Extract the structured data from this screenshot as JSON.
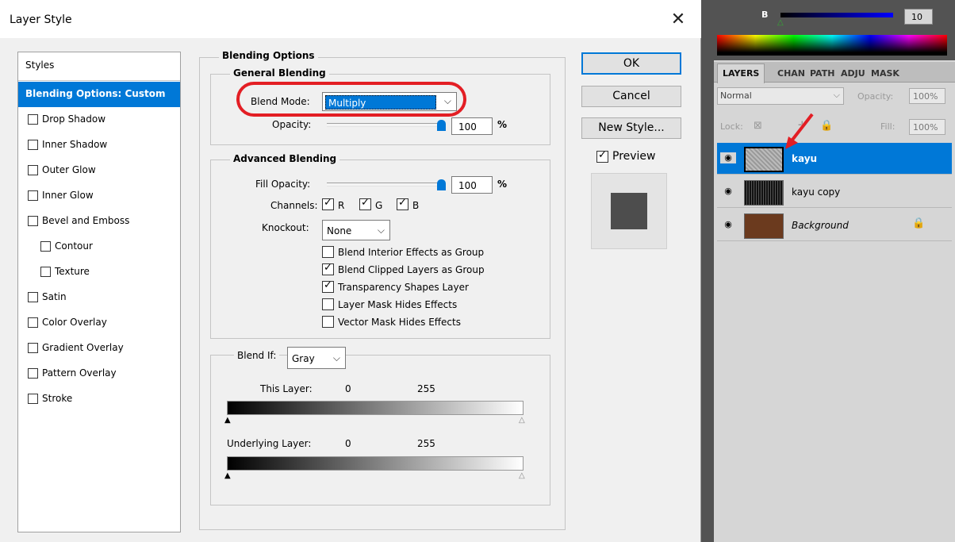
{
  "dialog": {
    "title": "Layer Style",
    "close_glyph": "✕",
    "styles": {
      "header": "Styles",
      "items": [
        {
          "label": "Blending Options: Custom",
          "selected": true,
          "checkbox": false
        },
        {
          "label": "Drop Shadow",
          "checkbox": true
        },
        {
          "label": "Inner Shadow",
          "checkbox": true
        },
        {
          "label": "Outer Glow",
          "checkbox": true
        },
        {
          "label": "Inner Glow",
          "checkbox": true
        },
        {
          "label": "Bevel and Emboss",
          "checkbox": true
        },
        {
          "label": "Contour",
          "checkbox": true
        },
        {
          "label": "Texture",
          "checkbox": true
        },
        {
          "label": "Satin",
          "checkbox": true
        },
        {
          "label": "Color Overlay",
          "checkbox": true
        },
        {
          "label": "Gradient Overlay",
          "checkbox": true
        },
        {
          "label": "Pattern Overlay",
          "checkbox": true
        },
        {
          "label": "Stroke",
          "checkbox": true
        }
      ]
    },
    "blending_options": {
      "title": "Blending Options",
      "general": {
        "title": "General Blending",
        "blend_mode_label": "Blend Mode:",
        "blend_mode_value": "Multiply",
        "opacity_label": "Opacity:",
        "opacity_value": "100",
        "unit": "%"
      },
      "advanced": {
        "title": "Advanced Blending",
        "fill_opacity_label": "Fill Opacity:",
        "fill_opacity_value": "100",
        "unit": "%",
        "channels_label": "Channels:",
        "channels": [
          {
            "label": "R",
            "checked": true
          },
          {
            "label": "G",
            "checked": true
          },
          {
            "label": "B",
            "checked": true
          }
        ],
        "knockout_label": "Knockout:",
        "knockout_value": "None",
        "options": [
          {
            "label": "Blend Interior Effects as Group",
            "checked": false
          },
          {
            "label": "Blend Clipped Layers as Group",
            "checked": true
          },
          {
            "label": "Transparency Shapes Layer",
            "checked": true
          },
          {
            "label": "Layer Mask Hides Effects",
            "checked": false
          },
          {
            "label": "Vector Mask Hides Effects",
            "checked": false
          }
        ]
      },
      "blend_if": {
        "label": "Blend If:",
        "value": "Gray",
        "this_layer_label": "This Layer:",
        "this_layer_min": "0",
        "this_layer_max": "255",
        "underlying_label": "Underlying Layer:",
        "underlying_min": "0",
        "underlying_max": "255"
      }
    },
    "buttons": {
      "ok": "OK",
      "cancel": "Cancel",
      "new_style": "New Style...",
      "preview_label": "Preview",
      "preview_checked": true
    },
    "check_glyph": "✓",
    "dropdown_glyph": "⌵",
    "annotation_color": "#e31e24"
  },
  "right_panel": {
    "color": {
      "b_label": "B",
      "b_value": "10"
    },
    "tabs": [
      "LAYERS",
      "CHAN",
      "PATH",
      "ADJU",
      "MASK"
    ],
    "blend_mode": "Normal",
    "opacity_label": "Opacity:",
    "opacity_value": "100%",
    "lock_label": "Lock:",
    "fill_label": "Fill:",
    "fill_value": "100%",
    "layers": [
      {
        "name": "kayu",
        "selected": true
      },
      {
        "name": "kayu copy",
        "selected": false
      },
      {
        "name": "Background",
        "selected": false,
        "locked": true,
        "italic": true
      }
    ],
    "accent": "#0078d7"
  }
}
